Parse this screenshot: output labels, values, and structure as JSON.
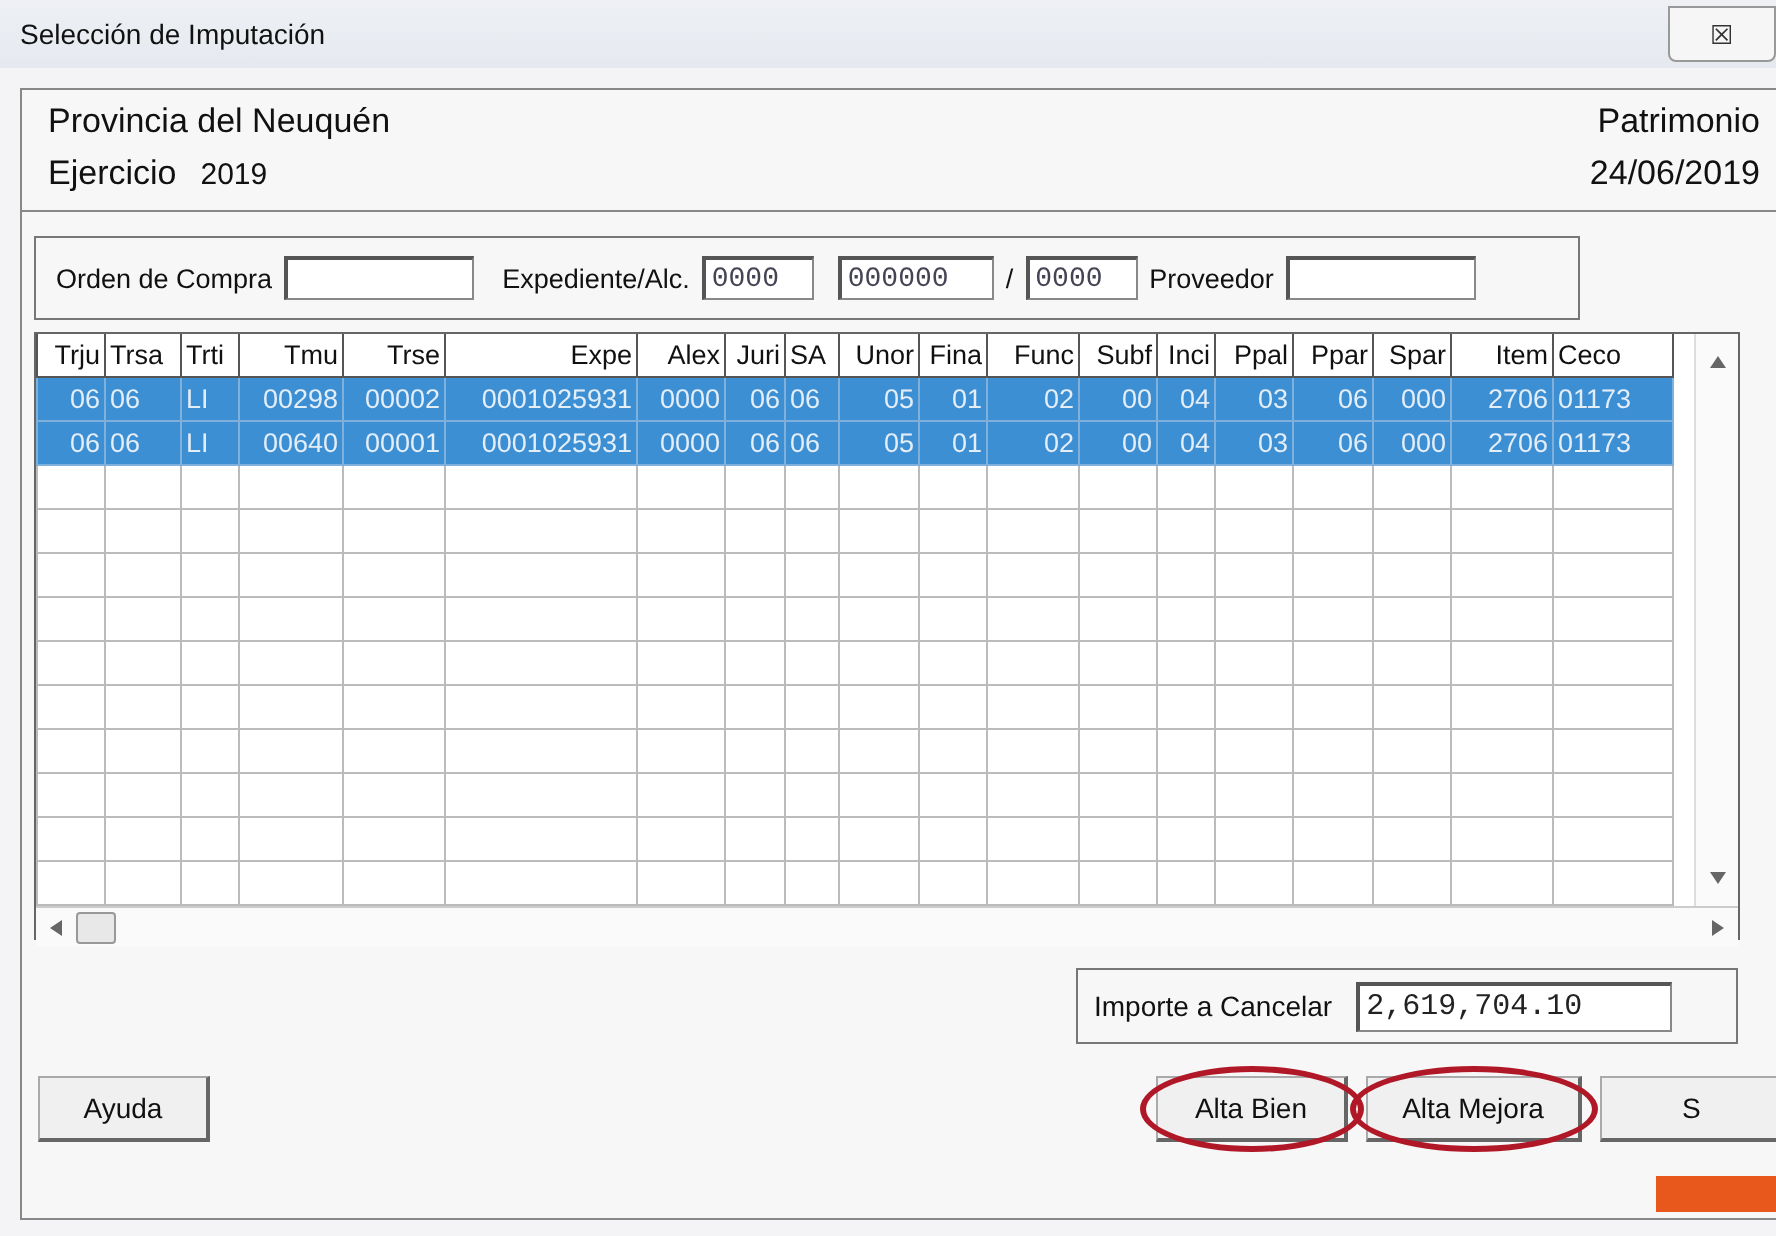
{
  "window": {
    "title": "Selección de Imputación",
    "close_icon": "☒"
  },
  "header": {
    "organization": "Provincia del Neuquén",
    "module": "Patrimonio",
    "year_label": "Ejercicio",
    "year": "2019",
    "date": "24/06/2019"
  },
  "filters": [
    {
      "label": "Orden de Compra",
      "kind": "wide"
    },
    {
      "label": "Expediente/Alc.",
      "value": "0000",
      "kind": "short"
    },
    {
      "value": "000000",
      "kind": "mid"
    },
    {
      "label": "/",
      "value": "0000",
      "kind": "short"
    },
    {
      "label": "Proveedor",
      "kind": "wide"
    }
  ],
  "table": {
    "columns": [
      "Trju",
      "Trsa",
      "Trti",
      "Tmu",
      "Trse",
      "Expe",
      "Alex",
      "Juri",
      "SA",
      "Unor",
      "Fina",
      "Func",
      "Subf",
      "Inci",
      "Ppal",
      "Ppar",
      "Spar",
      "Item",
      "Ceco"
    ],
    "rows": [
      {
        "selected": true,
        "cells": [
          "06",
          "06",
          "LI",
          "00298",
          "00002",
          "0001025931",
          "0000",
          "06",
          "06",
          "05",
          "01",
          "02",
          "00",
          "04",
          "03",
          "06",
          "000",
          "2706",
          "01173"
        ]
      },
      {
        "selected": true,
        "cells": [
          "06",
          "06",
          "LI",
          "00640",
          "00001",
          "0001025931",
          "0000",
          "06",
          "06",
          "05",
          "01",
          "02",
          "00",
          "04",
          "03",
          "06",
          "000",
          "2706",
          "01173"
        ]
      }
    ]
  },
  "total": {
    "label": "Importe a Cancelar",
    "value": "2,619,704.10"
  },
  "buttons": [
    {
      "label": "Ayuda",
      "circled": false
    },
    {
      "label": "Alta Bien",
      "circled": true
    },
    {
      "label": "Alta Mejora",
      "circled": true
    },
    {
      "label": "S",
      "circled": false
    }
  ]
}
